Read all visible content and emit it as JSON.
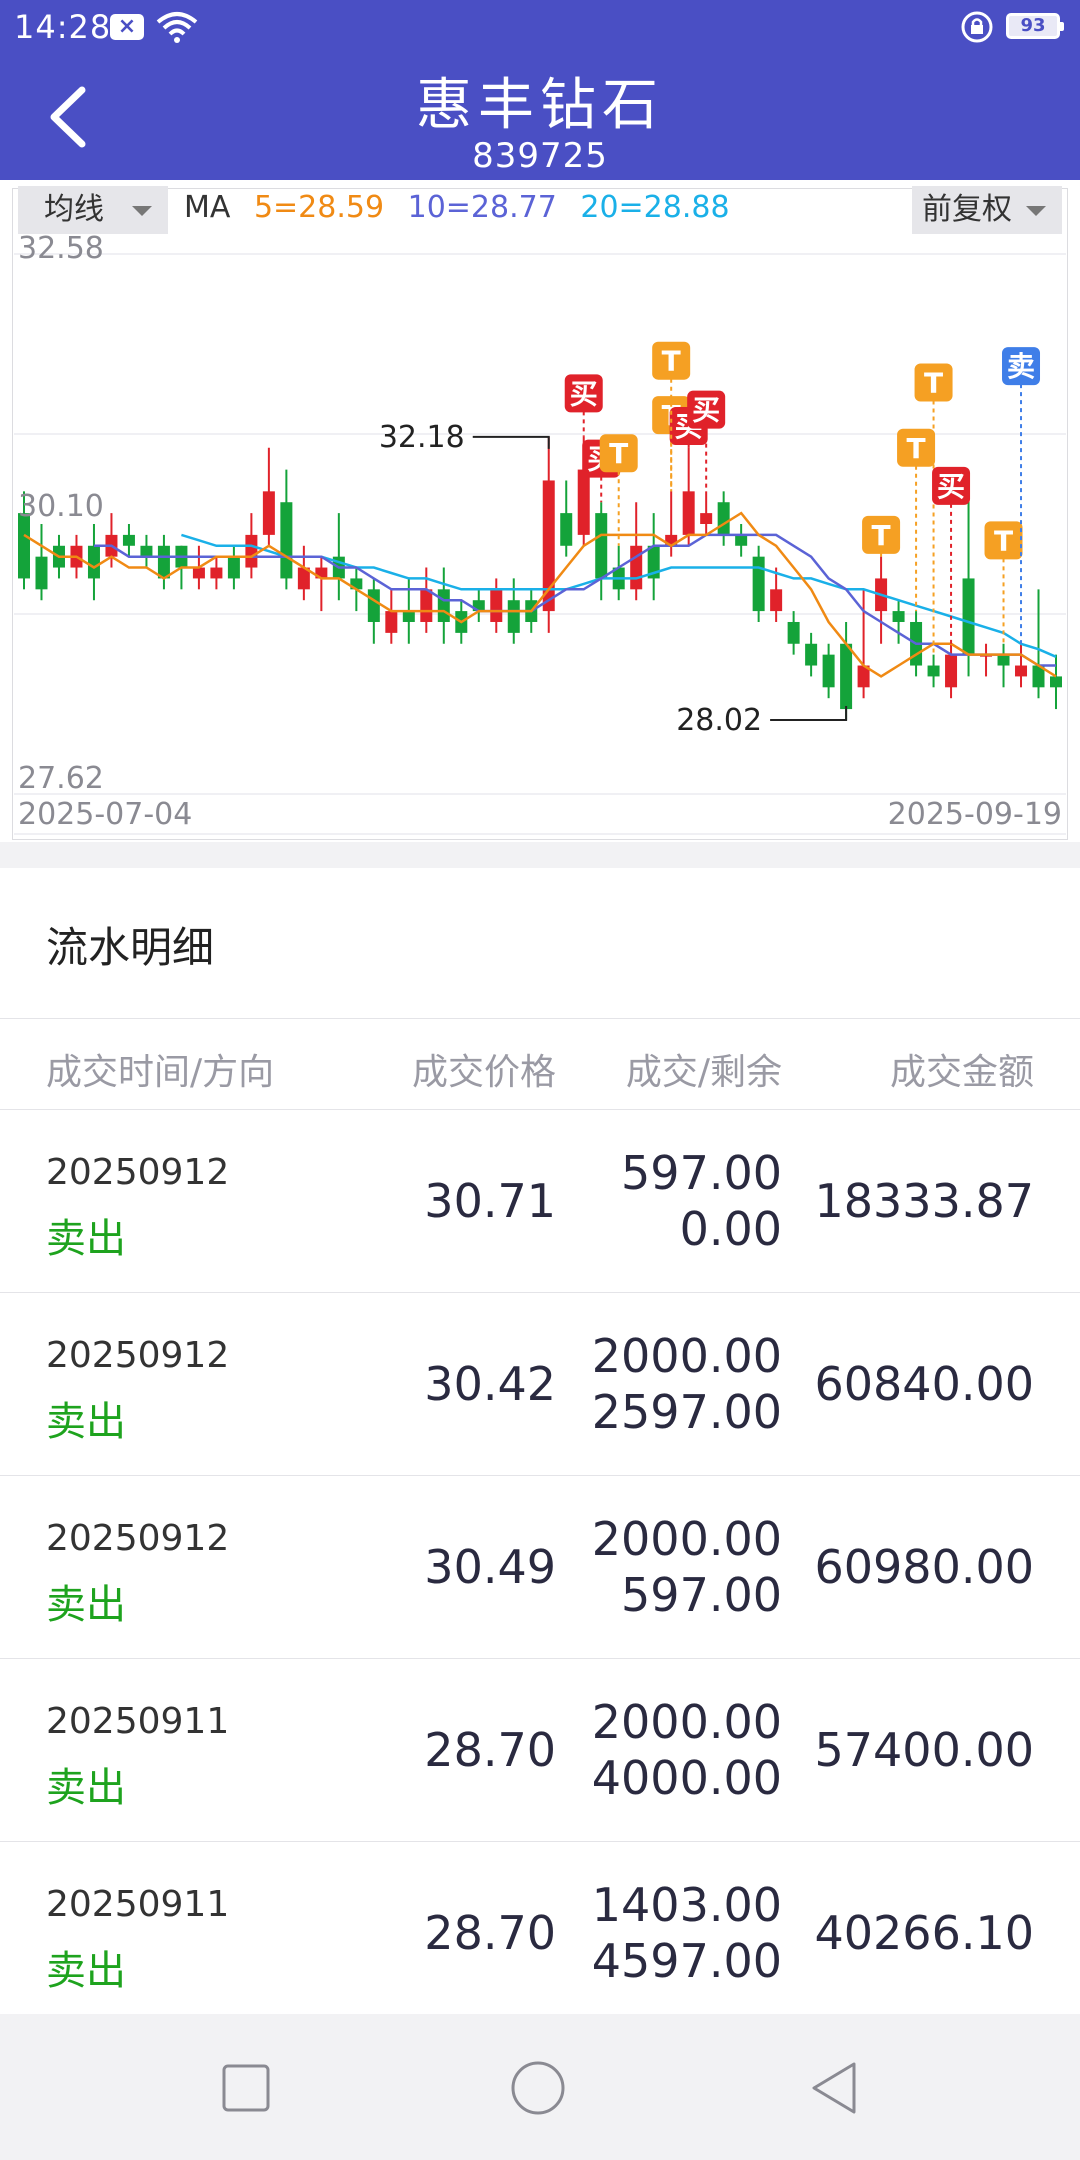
{
  "status_bar": {
    "time": "14:28",
    "battery": "93"
  },
  "header": {
    "title": "惠丰钻石",
    "code": "839725"
  },
  "chart_controls": {
    "ma_select": "均线",
    "ma_label": "MA",
    "ma5": "5=28.59",
    "ma10": "10=28.77",
    "ma20": "20=28.88",
    "adjust_select": "前复权",
    "colors": {
      "ma5": "#f08a14",
      "ma10": "#5b63d6",
      "ma20": "#1ab0e8",
      "up": "#e0222a",
      "down": "#14a33a"
    }
  },
  "chart_data": {
    "type": "candlestick",
    "y_max_label": "32.58",
    "y_mid_label": "30.10",
    "y_min_label": "27.62",
    "ylim": [
      27.62,
      32.58
    ],
    "x_start_label": "2025-07-04",
    "x_end_label": "2025-09-19",
    "high_label": "32.18",
    "low_label": "28.02",
    "candles": [
      {
        "o": 30.2,
        "c": 29.6,
        "h": 30.4,
        "l": 29.5
      },
      {
        "o": 29.8,
        "c": 29.5,
        "h": 30.1,
        "l": 29.4
      },
      {
        "o": 29.9,
        "c": 29.7,
        "h": 30.0,
        "l": 29.6
      },
      {
        "o": 29.7,
        "c": 29.9,
        "h": 30.0,
        "l": 29.6
      },
      {
        "o": 29.9,
        "c": 29.6,
        "h": 30.1,
        "l": 29.4
      },
      {
        "o": 29.8,
        "c": 30.0,
        "h": 30.2,
        "l": 29.7
      },
      {
        "o": 30.0,
        "c": 29.9,
        "h": 30.1,
        "l": 29.8
      },
      {
        "o": 29.9,
        "c": 29.8,
        "h": 30.0,
        "l": 29.7
      },
      {
        "o": 29.9,
        "c": 29.6,
        "h": 30.0,
        "l": 29.5
      },
      {
        "o": 29.9,
        "c": 29.7,
        "h": 29.9,
        "l": 29.5
      },
      {
        "o": 29.6,
        "c": 29.7,
        "h": 29.9,
        "l": 29.5
      },
      {
        "o": 29.6,
        "c": 29.7,
        "h": 29.8,
        "l": 29.5
      },
      {
        "o": 29.8,
        "c": 29.6,
        "h": 29.9,
        "l": 29.5
      },
      {
        "o": 29.7,
        "c": 30.0,
        "h": 30.2,
        "l": 29.6
      },
      {
        "o": 30.0,
        "c": 30.4,
        "h": 30.8,
        "l": 29.9
      },
      {
        "o": 30.3,
        "c": 29.6,
        "h": 30.6,
        "l": 29.5
      },
      {
        "o": 29.5,
        "c": 29.7,
        "h": 29.9,
        "l": 29.4
      },
      {
        "o": 29.6,
        "c": 29.7,
        "h": 29.8,
        "l": 29.3
      },
      {
        "o": 29.8,
        "c": 29.6,
        "h": 30.2,
        "l": 29.4
      },
      {
        "o": 29.6,
        "c": 29.5,
        "h": 29.7,
        "l": 29.3
      },
      {
        "o": 29.5,
        "c": 29.2,
        "h": 29.6,
        "l": 29.0
      },
      {
        "o": 29.1,
        "c": 29.3,
        "h": 29.5,
        "l": 29.0
      },
      {
        "o": 29.3,
        "c": 29.2,
        "h": 29.6,
        "l": 29.0
      },
      {
        "o": 29.2,
        "c": 29.5,
        "h": 29.7,
        "l": 29.1
      },
      {
        "o": 29.5,
        "c": 29.2,
        "h": 29.7,
        "l": 29.0
      },
      {
        "o": 29.3,
        "c": 29.1,
        "h": 29.4,
        "l": 29.0
      },
      {
        "o": 29.4,
        "c": 29.3,
        "h": 29.5,
        "l": 29.2
      },
      {
        "o": 29.2,
        "c": 29.5,
        "h": 29.6,
        "l": 29.1
      },
      {
        "o": 29.4,
        "c": 29.1,
        "h": 29.6,
        "l": 29.0
      },
      {
        "o": 29.4,
        "c": 29.2,
        "h": 29.5,
        "l": 29.1
      },
      {
        "o": 29.3,
        "c": 30.5,
        "h": 30.9,
        "l": 29.1
      },
      {
        "o": 30.2,
        "c": 29.9,
        "h": 30.5,
        "l": 29.8
      },
      {
        "o": 30.0,
        "c": 30.6,
        "h": 30.9,
        "l": 29.9
      },
      {
        "o": 30.2,
        "c": 29.6,
        "h": 30.3,
        "l": 29.4
      },
      {
        "o": 29.7,
        "c": 29.5,
        "h": 29.9,
        "l": 29.4
      },
      {
        "o": 29.5,
        "c": 29.9,
        "h": 30.3,
        "l": 29.4
      },
      {
        "o": 29.9,
        "c": 29.6,
        "h": 30.2,
        "l": 29.4
      },
      {
        "o": 29.9,
        "c": 30.0,
        "h": 30.4,
        "l": 29.8
      },
      {
        "o": 30.0,
        "c": 30.4,
        "h": 30.8,
        "l": 29.9
      },
      {
        "o": 30.1,
        "c": 30.2,
        "h": 30.4,
        "l": 30.0
      },
      {
        "o": 30.3,
        "c": 30.0,
        "h": 30.4,
        "l": 29.9
      },
      {
        "o": 30.0,
        "c": 29.9,
        "h": 30.1,
        "l": 29.8
      },
      {
        "o": 29.8,
        "c": 29.3,
        "h": 29.9,
        "l": 29.2
      },
      {
        "o": 29.3,
        "c": 29.5,
        "h": 29.7,
        "l": 29.2
      },
      {
        "o": 29.2,
        "c": 29.0,
        "h": 29.3,
        "l": 28.9
      },
      {
        "o": 29.0,
        "c": 28.8,
        "h": 29.1,
        "l": 28.7
      },
      {
        "o": 28.9,
        "c": 28.6,
        "h": 29.0,
        "l": 28.5
      },
      {
        "o": 29.0,
        "c": 28.4,
        "h": 29.2,
        "l": 28.3
      },
      {
        "o": 28.6,
        "c": 28.8,
        "h": 29.5,
        "l": 28.5
      },
      {
        "o": 29.3,
        "c": 29.6,
        "h": 29.8,
        "l": 29.0
      },
      {
        "o": 29.3,
        "c": 29.2,
        "h": 29.4,
        "l": 29.0
      },
      {
        "o": 29.2,
        "c": 28.8,
        "h": 29.3,
        "l": 28.7
      },
      {
        "o": 28.8,
        "c": 28.7,
        "h": 28.9,
        "l": 28.6
      },
      {
        "o": 28.6,
        "c": 28.9,
        "h": 29.0,
        "l": 28.5
      },
      {
        "o": 29.6,
        "c": 28.9,
        "h": 30.4,
        "l": 28.7
      },
      {
        "o": 28.9,
        "c": 28.9,
        "h": 29.0,
        "l": 28.7
      },
      {
        "o": 28.9,
        "c": 28.8,
        "h": 29.0,
        "l": 28.6
      },
      {
        "o": 28.7,
        "c": 28.8,
        "h": 29.0,
        "l": 28.6
      },
      {
        "o": 28.8,
        "c": 28.6,
        "h": 29.5,
        "l": 28.5
      },
      {
        "o": 28.7,
        "c": 28.6,
        "h": 28.9,
        "l": 28.4
      }
    ],
    "ma5": [
      30.0,
      29.9,
      29.8,
      29.8,
      29.7,
      29.8,
      29.7,
      29.7,
      29.6,
      29.7,
      29.7,
      29.8,
      29.8,
      29.8,
      29.9,
      29.8,
      29.7,
      29.6,
      29.6,
      29.5,
      29.4,
      29.3,
      29.3,
      29.3,
      29.3,
      29.2,
      29.3,
      29.3,
      29.3,
      29.3,
      29.5,
      29.7,
      29.9,
      30.0,
      30.0,
      30.0,
      30.0,
      29.9,
      30.0,
      30.0,
      30.1,
      30.2,
      30.0,
      29.9,
      29.7,
      29.5,
      29.2,
      29.0,
      28.8,
      28.7,
      28.8,
      28.9,
      29.0,
      29.0,
      28.9,
      28.9,
      28.9,
      28.9,
      28.8,
      28.7
    ],
    "ma10": [
      null,
      null,
      null,
      null,
      29.9,
      29.9,
      29.8,
      29.8,
      29.8,
      29.8,
      29.8,
      29.8,
      29.8,
      29.8,
      29.8,
      29.8,
      29.8,
      29.8,
      29.7,
      29.7,
      29.6,
      29.5,
      29.5,
      29.5,
      29.4,
      29.4,
      29.3,
      29.3,
      29.3,
      29.3,
      29.4,
      29.5,
      29.5,
      29.6,
      29.7,
      29.8,
      29.9,
      29.9,
      29.9,
      30.0,
      30.0,
      30.0,
      30.0,
      30.0,
      29.9,
      29.8,
      29.6,
      29.5,
      29.3,
      29.2,
      29.1,
      29.0,
      29.0,
      28.9,
      28.9,
      28.9,
      28.9,
      28.9,
      28.8,
      28.8
    ],
    "ma20": [
      null,
      null,
      null,
      null,
      null,
      null,
      null,
      null,
      null,
      30.0,
      29.95,
      29.9,
      29.9,
      29.9,
      29.85,
      29.8,
      29.8,
      29.8,
      29.75,
      29.7,
      29.7,
      29.65,
      29.6,
      29.6,
      29.55,
      29.5,
      29.5,
      29.5,
      29.5,
      29.5,
      29.5,
      29.5,
      29.55,
      29.6,
      29.6,
      29.6,
      29.65,
      29.7,
      29.7,
      29.7,
      29.7,
      29.7,
      29.7,
      29.65,
      29.6,
      29.6,
      29.55,
      29.5,
      29.5,
      29.45,
      29.4,
      29.35,
      29.3,
      29.25,
      29.2,
      29.15,
      29.1,
      29.0,
      28.95,
      28.88
    ],
    "markers": [
      {
        "i": 32,
        "label": "买",
        "color": "#e0222a",
        "y": 31.3
      },
      {
        "i": 33,
        "label": "买",
        "color": "#e0222a",
        "y": 30.7
      },
      {
        "i": 34,
        "label": "T",
        "color": "#f5a023",
        "y": 30.75
      },
      {
        "i": 37,
        "label": "T",
        "color": "#f5a023",
        "y": 31.1
      },
      {
        "i": 38,
        "label": "买",
        "color": "#e0222a",
        "y": 31.0
      },
      {
        "i": 39,
        "label": "买",
        "color": "#e0222a",
        "y": 31.15
      },
      {
        "i": 37,
        "label": "T",
        "color": "#f5a023",
        "y": 31.6
      },
      {
        "i": 49,
        "label": "T",
        "color": "#f5a023",
        "y": 30.0
      },
      {
        "i": 51,
        "label": "T",
        "color": "#f5a023",
        "y": 30.8
      },
      {
        "i": 52,
        "label": "T",
        "color": "#f5a023",
        "y": 31.4
      },
      {
        "i": 53,
        "label": "买",
        "color": "#e0222a",
        "y": 30.45
      },
      {
        "i": 56,
        "label": "T",
        "color": "#f5a023",
        "y": 29.95
      },
      {
        "i": 57,
        "label": "卖",
        "color": "#3f7ee8",
        "y": 31.55
      }
    ]
  },
  "trades": {
    "title": "流水明细",
    "columns": [
      "成交时间/方向",
      "成交价格",
      "成交/剩余",
      "成交金额"
    ],
    "rows": [
      {
        "date": "20250912",
        "dir": "卖出",
        "price": "30.71",
        "qty": "597.00",
        "remain": "0.00",
        "amount": "18333.87"
      },
      {
        "date": "20250912",
        "dir": "卖出",
        "price": "30.42",
        "qty": "2000.00",
        "remain": "2597.00",
        "amount": "60840.00"
      },
      {
        "date": "20250912",
        "dir": "卖出",
        "price": "30.49",
        "qty": "2000.00",
        "remain": "597.00",
        "amount": "60980.00"
      },
      {
        "date": "20250911",
        "dir": "卖出",
        "price": "28.70",
        "qty": "2000.00",
        "remain": "4000.00",
        "amount": "57400.00"
      },
      {
        "date": "20250911",
        "dir": "卖出",
        "price": "28.70",
        "qty": "1403.00",
        "remain": "4597.00",
        "amount": "40266.10"
      }
    ]
  },
  "nav": {
    "icons": [
      "recent-apps-icon",
      "home-icon",
      "back-icon"
    ]
  }
}
